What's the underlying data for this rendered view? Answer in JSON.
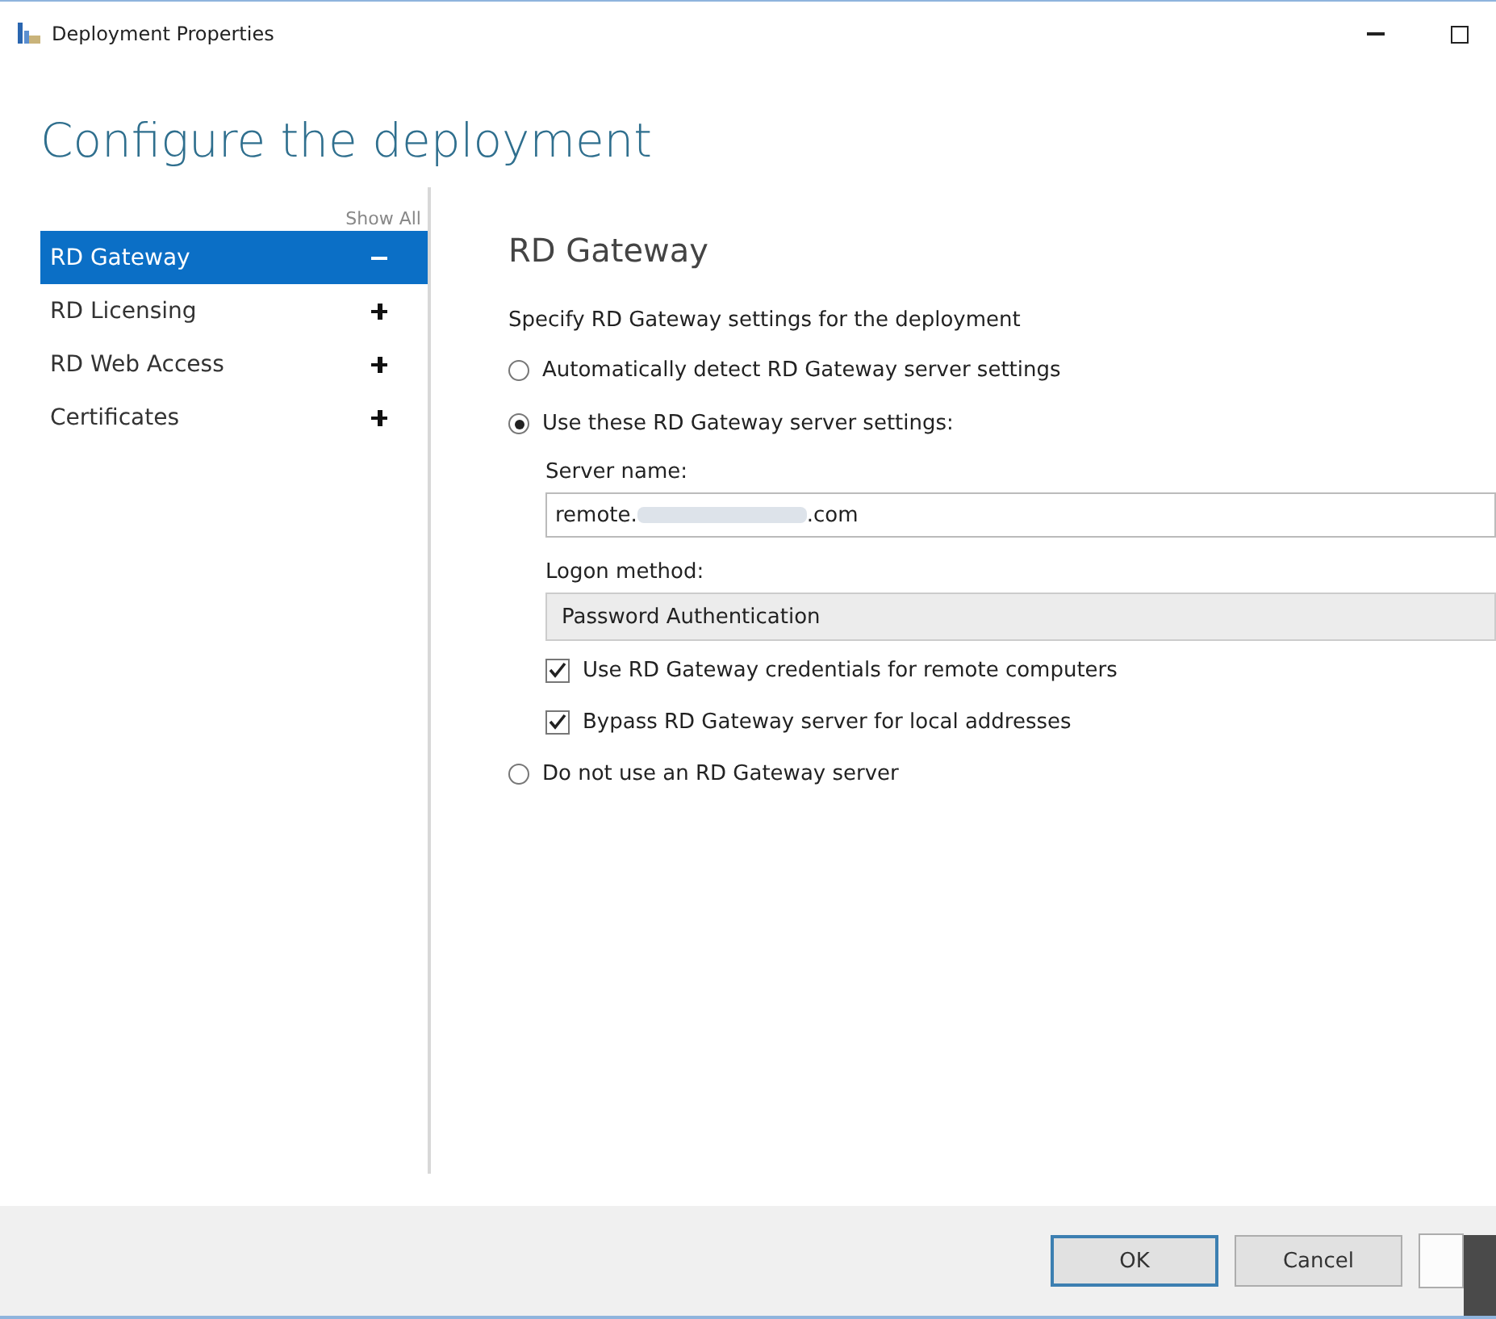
{
  "window": {
    "title": "Deployment Properties"
  },
  "heading": "Configure the deployment",
  "sidebar": {
    "show_all": "Show All",
    "items": [
      {
        "label": "RD Gateway",
        "selected": true,
        "expanded": true
      },
      {
        "label": "RD Licensing",
        "selected": false,
        "expanded": false
      },
      {
        "label": "RD Web Access",
        "selected": false,
        "expanded": false
      },
      {
        "label": "Certificates",
        "selected": false,
        "expanded": false
      }
    ]
  },
  "panel": {
    "title": "RD Gateway",
    "description": "Specify RD Gateway settings for the deployment",
    "options": [
      {
        "kind": "radio",
        "label": "Automatically detect RD Gateway server settings",
        "selected": false
      },
      {
        "kind": "radio",
        "label": "Use these RD Gateway server settings:",
        "selected": true
      },
      {
        "kind": "label",
        "label": "Server name:"
      },
      {
        "kind": "text",
        "value_start": "remote.",
        "value_end": ".com",
        "redacted": true
      },
      {
        "kind": "label",
        "label": "Logon method:"
      },
      {
        "kind": "select",
        "value": "Password Authentication"
      },
      {
        "kind": "checkbox",
        "label": "Use RD Gateway credentials for remote computers",
        "checked": true
      },
      {
        "kind": "checkbox",
        "label": "Bypass RD Gateway server for local addresses",
        "checked": true
      },
      {
        "kind": "radio",
        "label": "Do not use an RD Gateway server",
        "selected": false
      }
    ]
  },
  "buttons": [
    {
      "kind": "push",
      "label": "OK",
      "default": true
    },
    {
      "kind": "push",
      "label": "Cancel",
      "default": false
    },
    {
      "kind": "partial"
    }
  ]
}
